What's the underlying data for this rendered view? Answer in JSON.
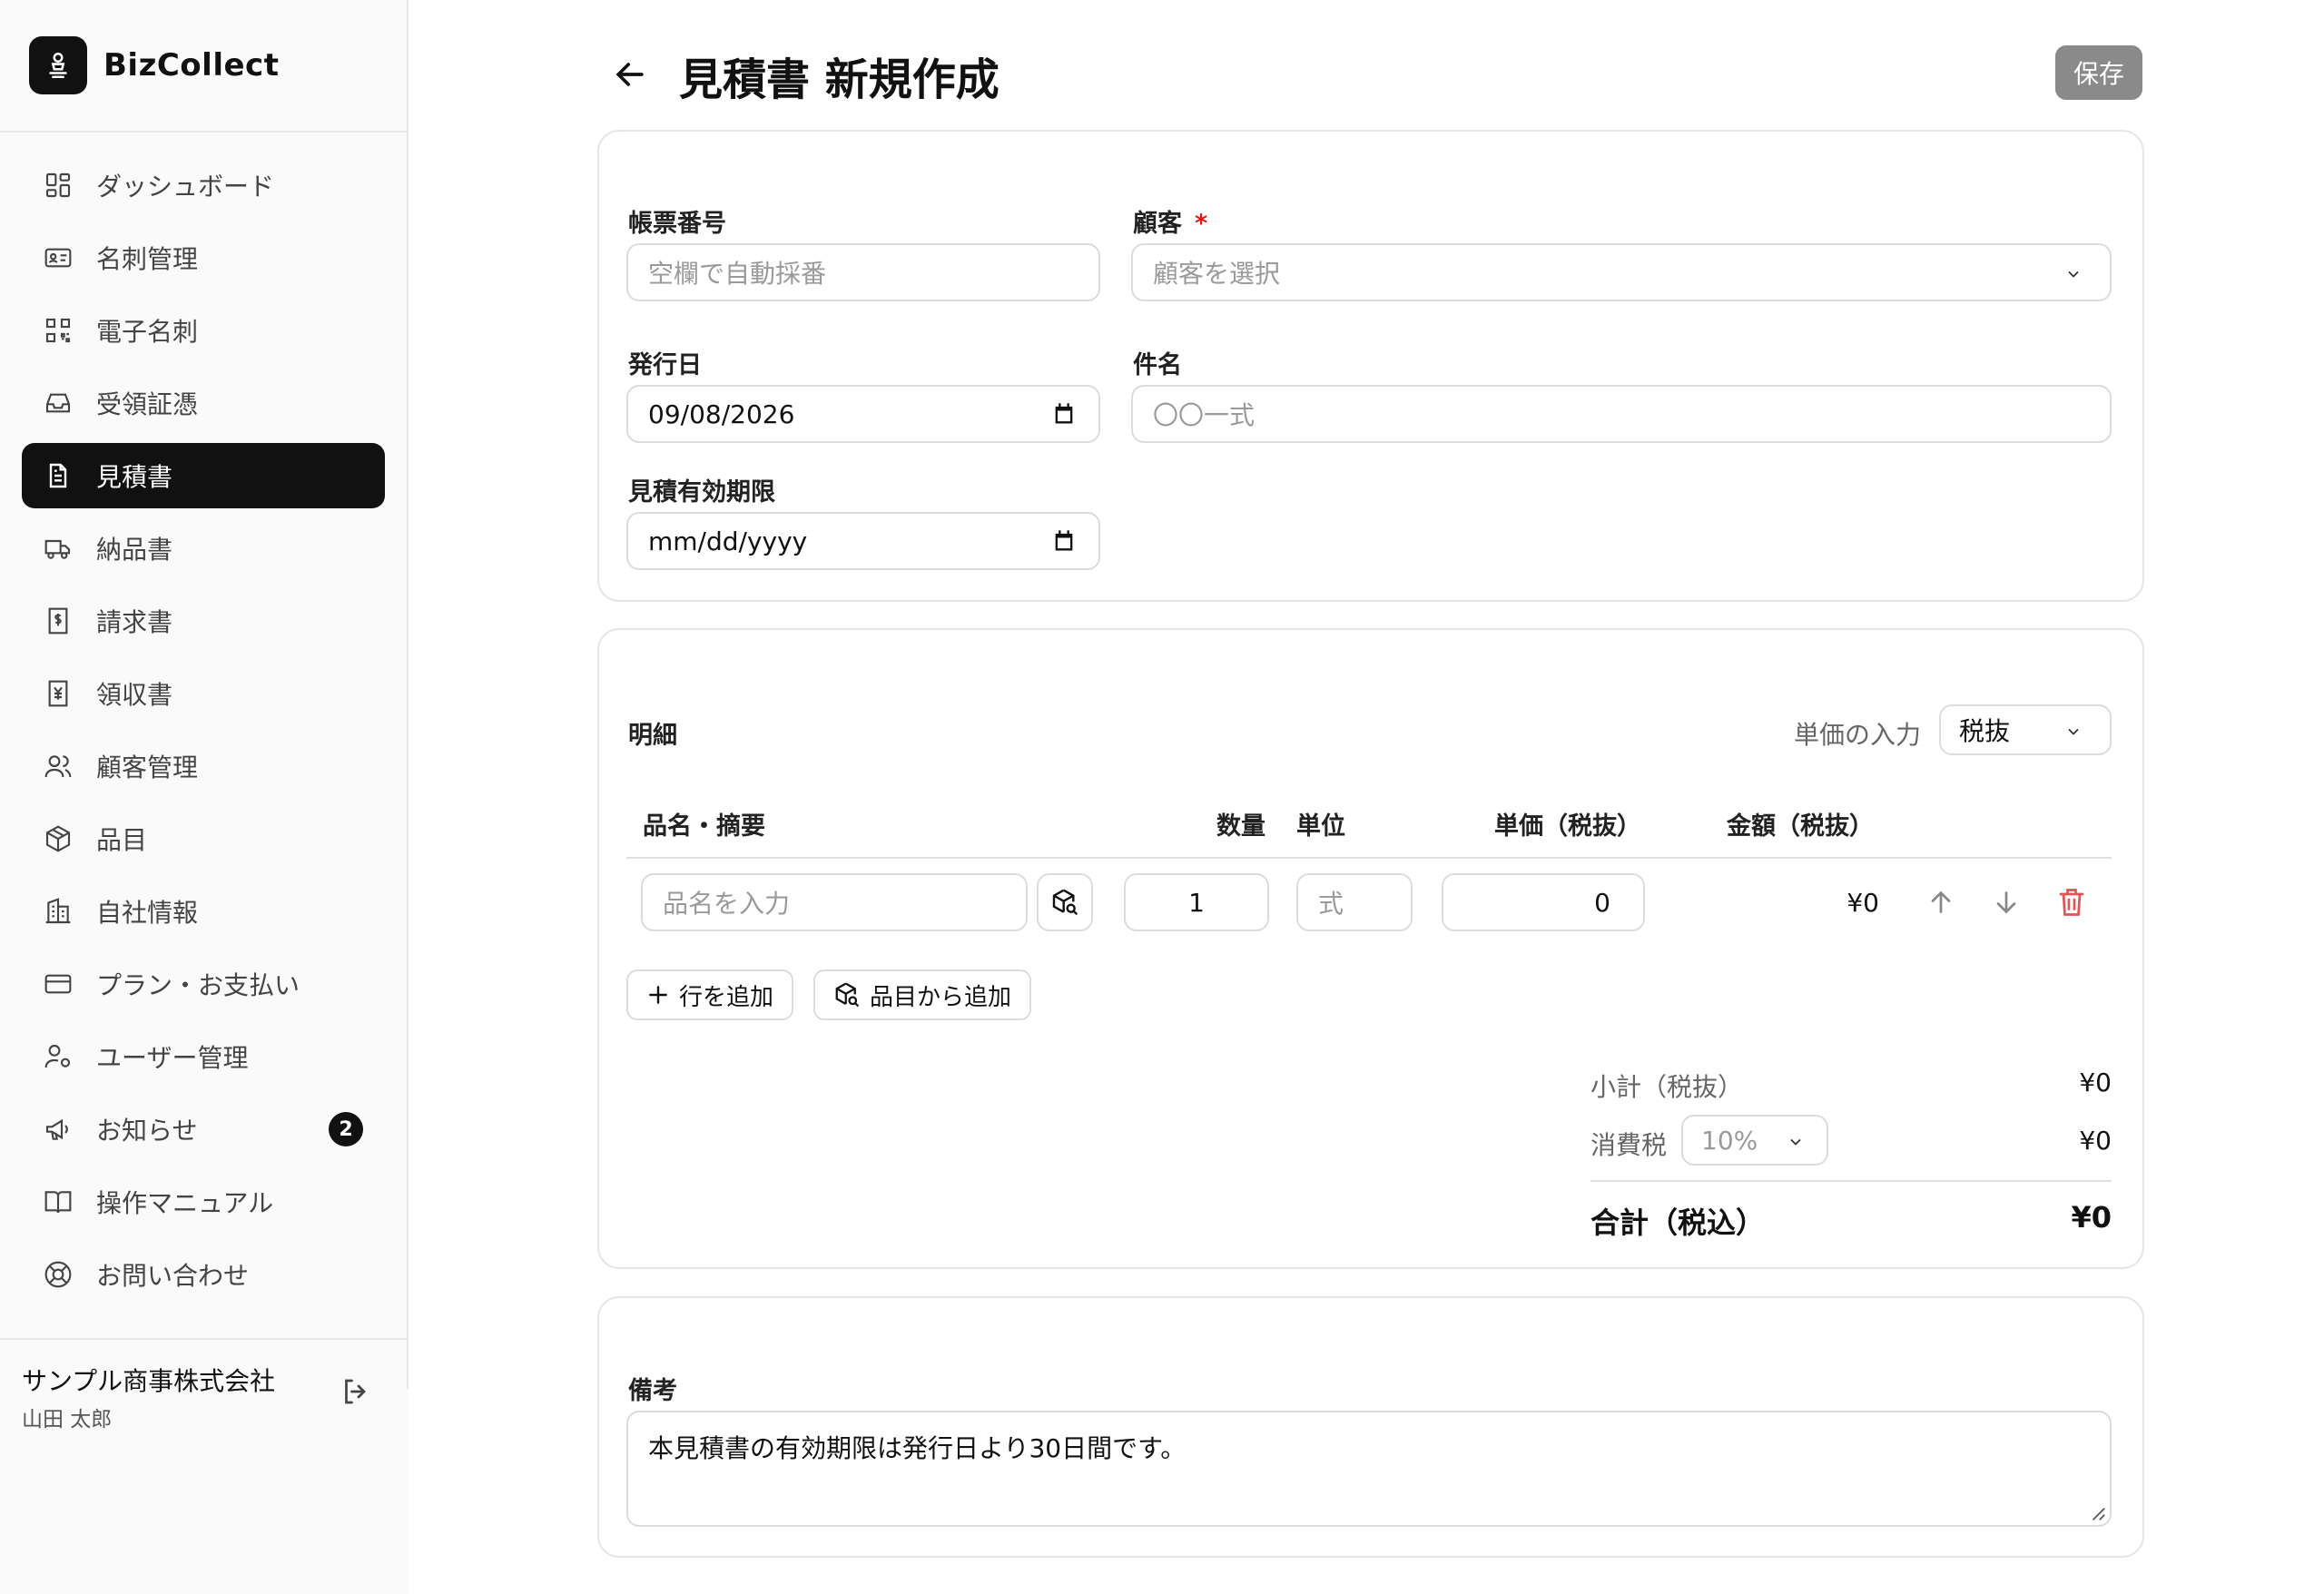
{
  "brand": {
    "name": "BizCollect"
  },
  "sidebar": {
    "items": [
      {
        "label": "ダッシュボード",
        "icon": "dashboard-icon"
      },
      {
        "label": "名刺管理",
        "icon": "id-card-icon"
      },
      {
        "label": "電子名刺",
        "icon": "qr-code-icon"
      },
      {
        "label": "受領証憑",
        "icon": "inbox-icon"
      },
      {
        "label": "見積書",
        "icon": "file-text-icon",
        "active": true
      },
      {
        "label": "納品書",
        "icon": "truck-icon"
      },
      {
        "label": "請求書",
        "icon": "invoice-dollar-icon"
      },
      {
        "label": "領収書",
        "icon": "receipt-yen-icon"
      },
      {
        "label": "顧客管理",
        "icon": "users-icon"
      },
      {
        "label": "品目",
        "icon": "package-icon"
      },
      {
        "label": "自社情報",
        "icon": "building-icon"
      },
      {
        "label": "プラン・お支払い",
        "icon": "credit-card-icon"
      },
      {
        "label": "ユーザー管理",
        "icon": "user-cog-icon"
      },
      {
        "label": "お知らせ",
        "icon": "megaphone-icon",
        "badge": "2"
      },
      {
        "label": "操作マニュアル",
        "icon": "book-icon"
      },
      {
        "label": "お問い合わせ",
        "icon": "lifebuoy-icon"
      }
    ],
    "company": "サンプル商事株式会社",
    "user": "山田 太郎"
  },
  "header": {
    "title": "見積書 新規作成",
    "save_label": "保存"
  },
  "form": {
    "doc_number": {
      "label": "帳票番号",
      "placeholder": "空欄で自動採番"
    },
    "customer": {
      "label": "顧客",
      "required": "*",
      "placeholder": "顧客を選択"
    },
    "issue_date": {
      "label": "発行日",
      "value": "09/08/2026"
    },
    "subject": {
      "label": "件名",
      "placeholder": "〇〇一式"
    },
    "valid_until": {
      "label": "見積有効期限",
      "placeholder": "mm/dd/yyyy"
    }
  },
  "details": {
    "title": "明細",
    "price_mode_label": "単価の入力",
    "price_mode_value": "税抜",
    "columns": [
      "品名・摘要",
      "数量",
      "単位",
      "単価（税抜）",
      "金額（税抜）"
    ],
    "row": {
      "name_placeholder": "品名を入力",
      "qty": "1",
      "unit_placeholder": "式",
      "price": "0",
      "amount": "¥0"
    },
    "add_row_label": "行を追加",
    "add_from_items_label": "品目から追加",
    "subtotal_label": "小計（税抜）",
    "subtotal_value": "¥0",
    "tax_label": "消費税",
    "tax_rate": "10%",
    "tax_value": "¥0",
    "total_label": "合計（税込）",
    "total_value": "¥0"
  },
  "notes": {
    "label": "備考",
    "value": "本見積書の有効期限は発行日より30日間です。"
  }
}
